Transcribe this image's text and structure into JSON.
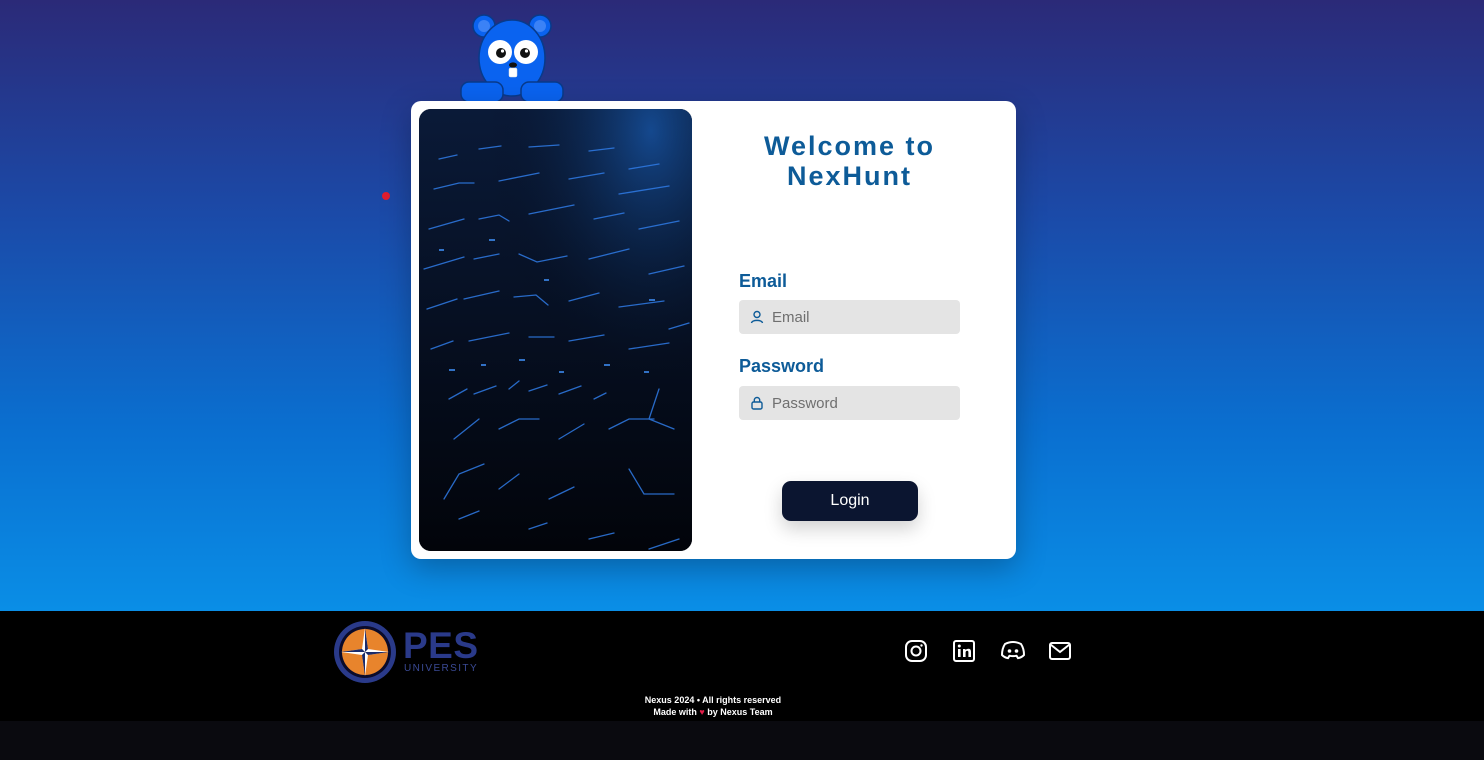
{
  "brand": {
    "welcome_line1": "Welcome to",
    "welcome_line2": "NexHunt"
  },
  "form": {
    "email_label": "Email",
    "email_placeholder": "Email",
    "email_value": "",
    "password_label": "Password",
    "password_placeholder": "Password",
    "password_value": "",
    "login_label": "Login"
  },
  "footer": {
    "university_name": "PES",
    "university_sub": "UNIVERSITY",
    "socials": [
      "instagram-icon",
      "linkedin-icon",
      "discord-icon",
      "mail-icon"
    ],
    "copyright": "Nexus 2024 • All rights reserved",
    "made_with": "Made with",
    "by": "by Nexus Team"
  },
  "colors": {
    "accent_text": "#0d5b98",
    "button_bg": "#0b1530",
    "hero_top": "#2b2a78",
    "hero_bottom": "#0a8ee6",
    "mascot_blue": "#0a63f0"
  }
}
